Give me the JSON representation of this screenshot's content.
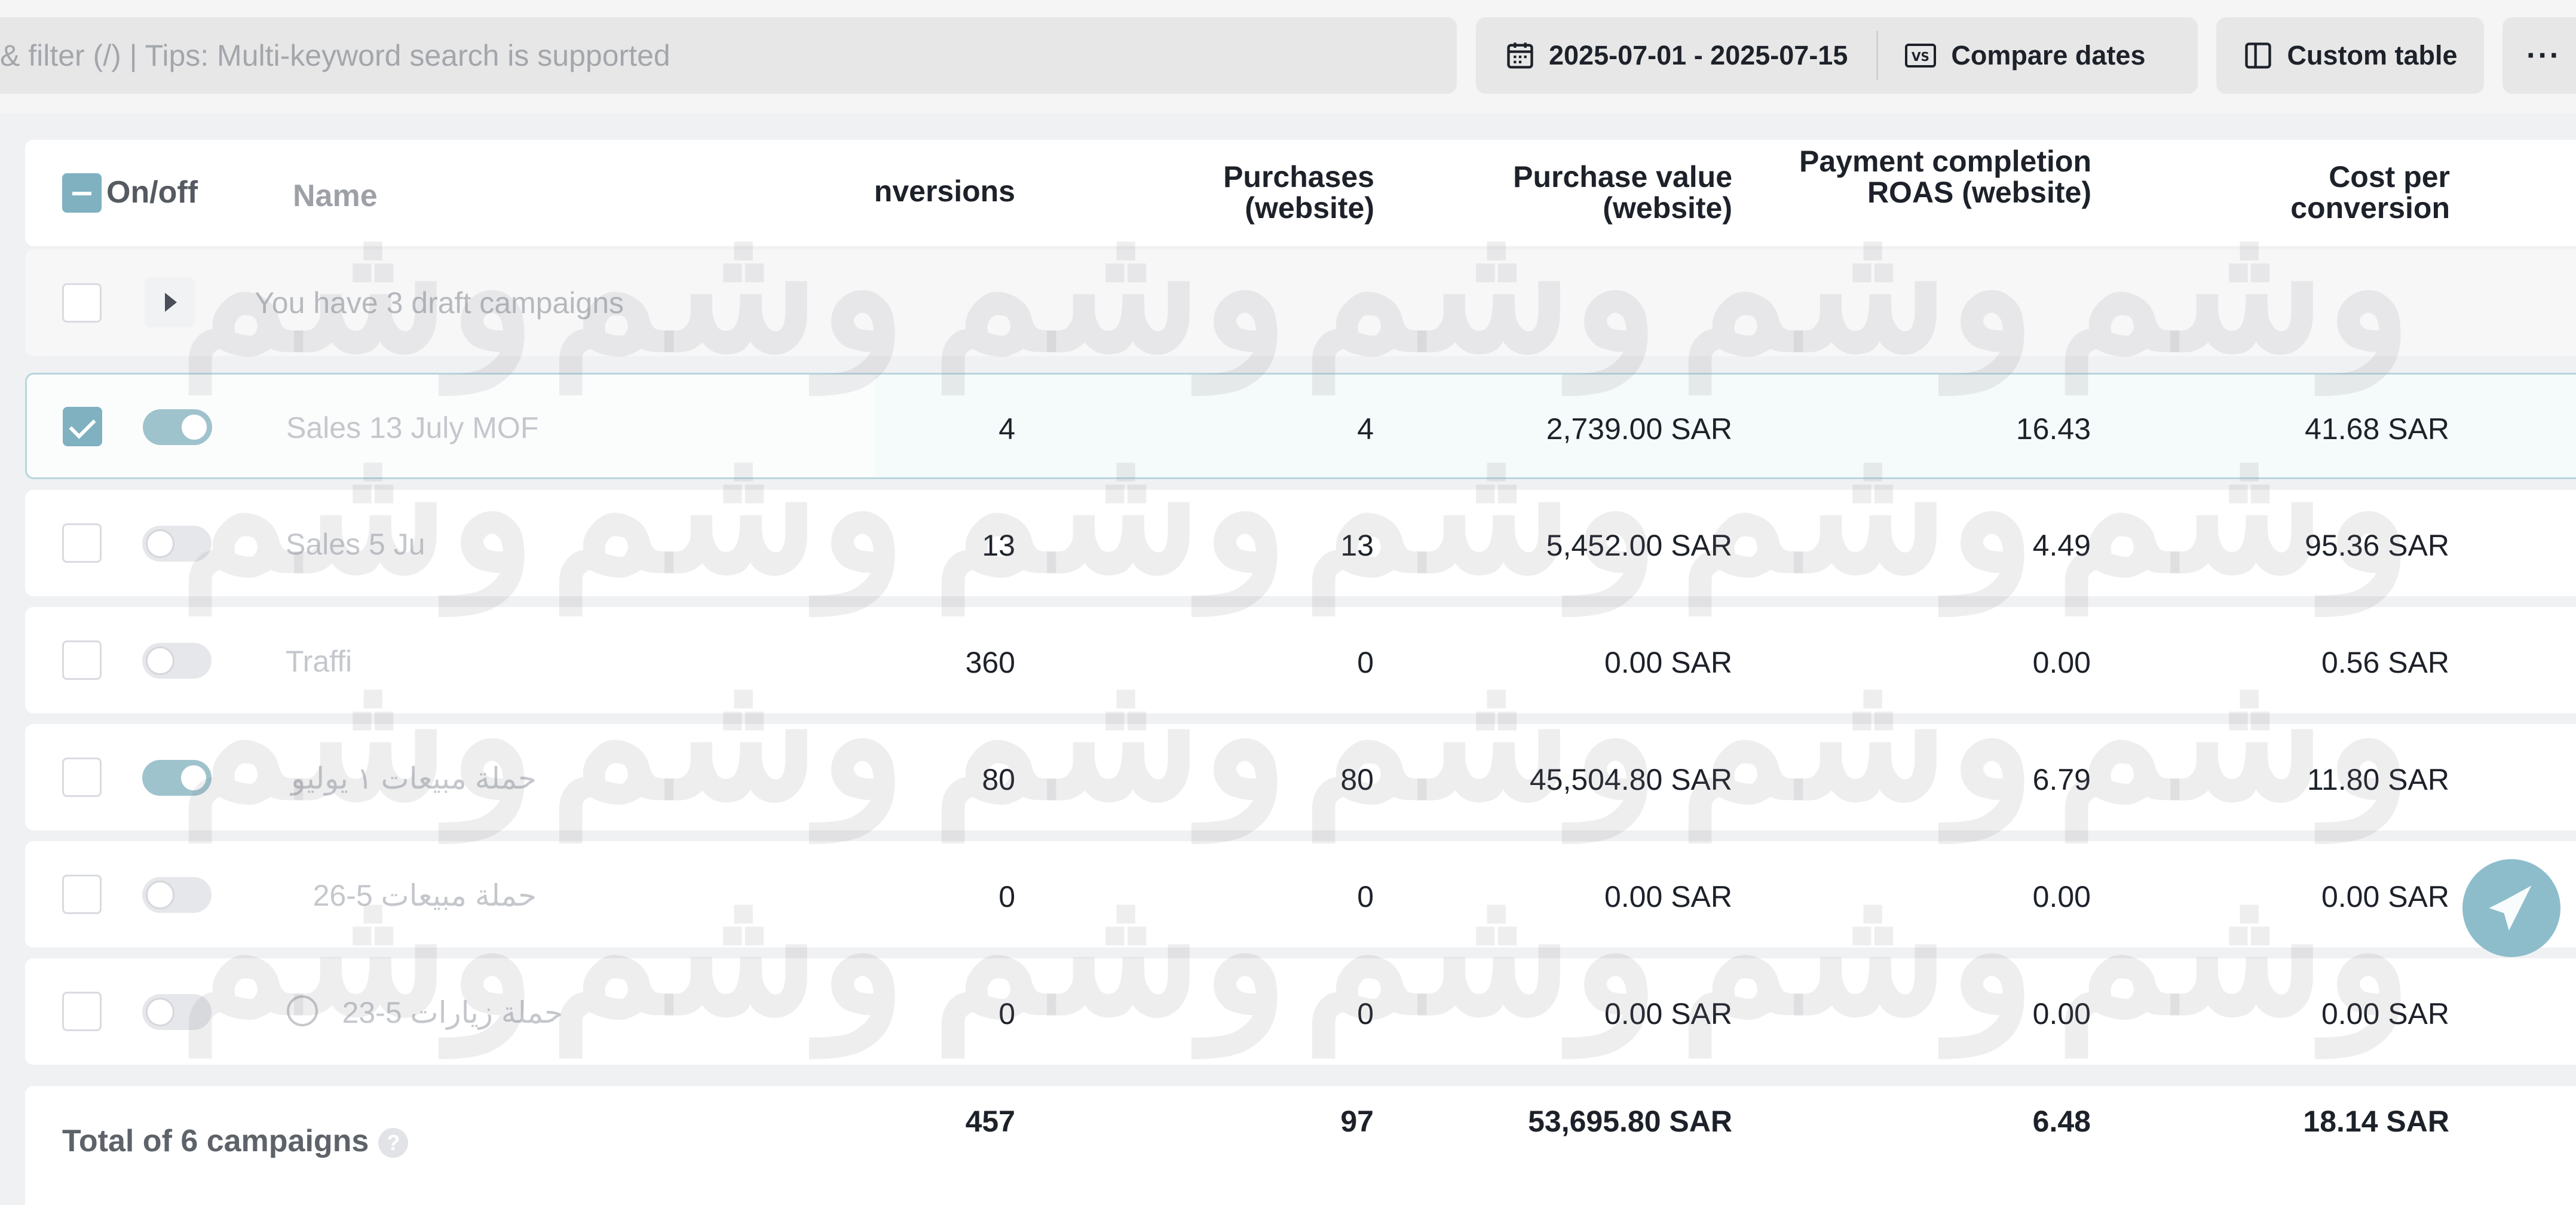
{
  "toolbar": {
    "search_placeholder": "& filter (/) | Tips: Multi-keyword search is supported",
    "date_range": "2025-07-01 - 2025-07-15",
    "compare_dates": "Compare dates",
    "custom_table": "Custom table",
    "more": "···"
  },
  "table": {
    "header": {
      "on_off": "On/off",
      "name": "Name",
      "conversions": "nversions",
      "purchases": "Purchases (website)",
      "purchase_value": "Purchase value (website)",
      "roas": "Payment completion ROAS (website)",
      "cost_per_conversion": "Cost per conversion"
    },
    "draft_row": "You have 3 draft campaigns",
    "rows": [
      {
        "name": "Sales 13 July MOF",
        "status": "on",
        "checked": true,
        "conversions": "4",
        "purchases": "4",
        "purchase_value": "2,739.00 SAR",
        "roas": "16.43",
        "cost": "41.68 SAR"
      },
      {
        "name": "Sales 5 Ju",
        "status": "off",
        "checked": false,
        "conversions": "13",
        "purchases": "13",
        "purchase_value": "5,452.00 SAR",
        "roas": "4.49",
        "cost": "95.36 SAR"
      },
      {
        "name": "Traffi",
        "status": "off",
        "checked": false,
        "conversions": "360",
        "purchases": "0",
        "purchase_value": "0.00 SAR",
        "roas": "0.00",
        "cost": "0.56 SAR"
      },
      {
        "name": "حملة مبيعات ١ يوليو",
        "status": "on",
        "checked": false,
        "conversions": "80",
        "purchases": "80",
        "purchase_value": "45,504.80 SAR",
        "roas": "6.79",
        "cost": "11.80 SAR"
      },
      {
        "name": "حملة مبيعات 5-26",
        "status": "off",
        "checked": false,
        "conversions": "0",
        "purchases": "0",
        "purchase_value": "0.00 SAR",
        "roas": "0.00",
        "cost": "0.00 SAR"
      },
      {
        "name": "حملة زيارات 5-23",
        "status": "off",
        "checked": false,
        "conversions": "0",
        "purchases": "0",
        "purchase_value": "0.00 SAR",
        "roas": "0.00",
        "cost": "0.00 SAR"
      }
    ],
    "total": {
      "label": "Total of 6 campaigns",
      "help": "?",
      "conversions": "457",
      "purchases": "97",
      "purchase_value": "53,695.80 SAR",
      "roas": "6.48",
      "cost": "18.14 SAR"
    }
  },
  "watermark": "وشم",
  "colors": {
    "accent": "#7fb1c0",
    "float_button": "#8dbdcb"
  }
}
